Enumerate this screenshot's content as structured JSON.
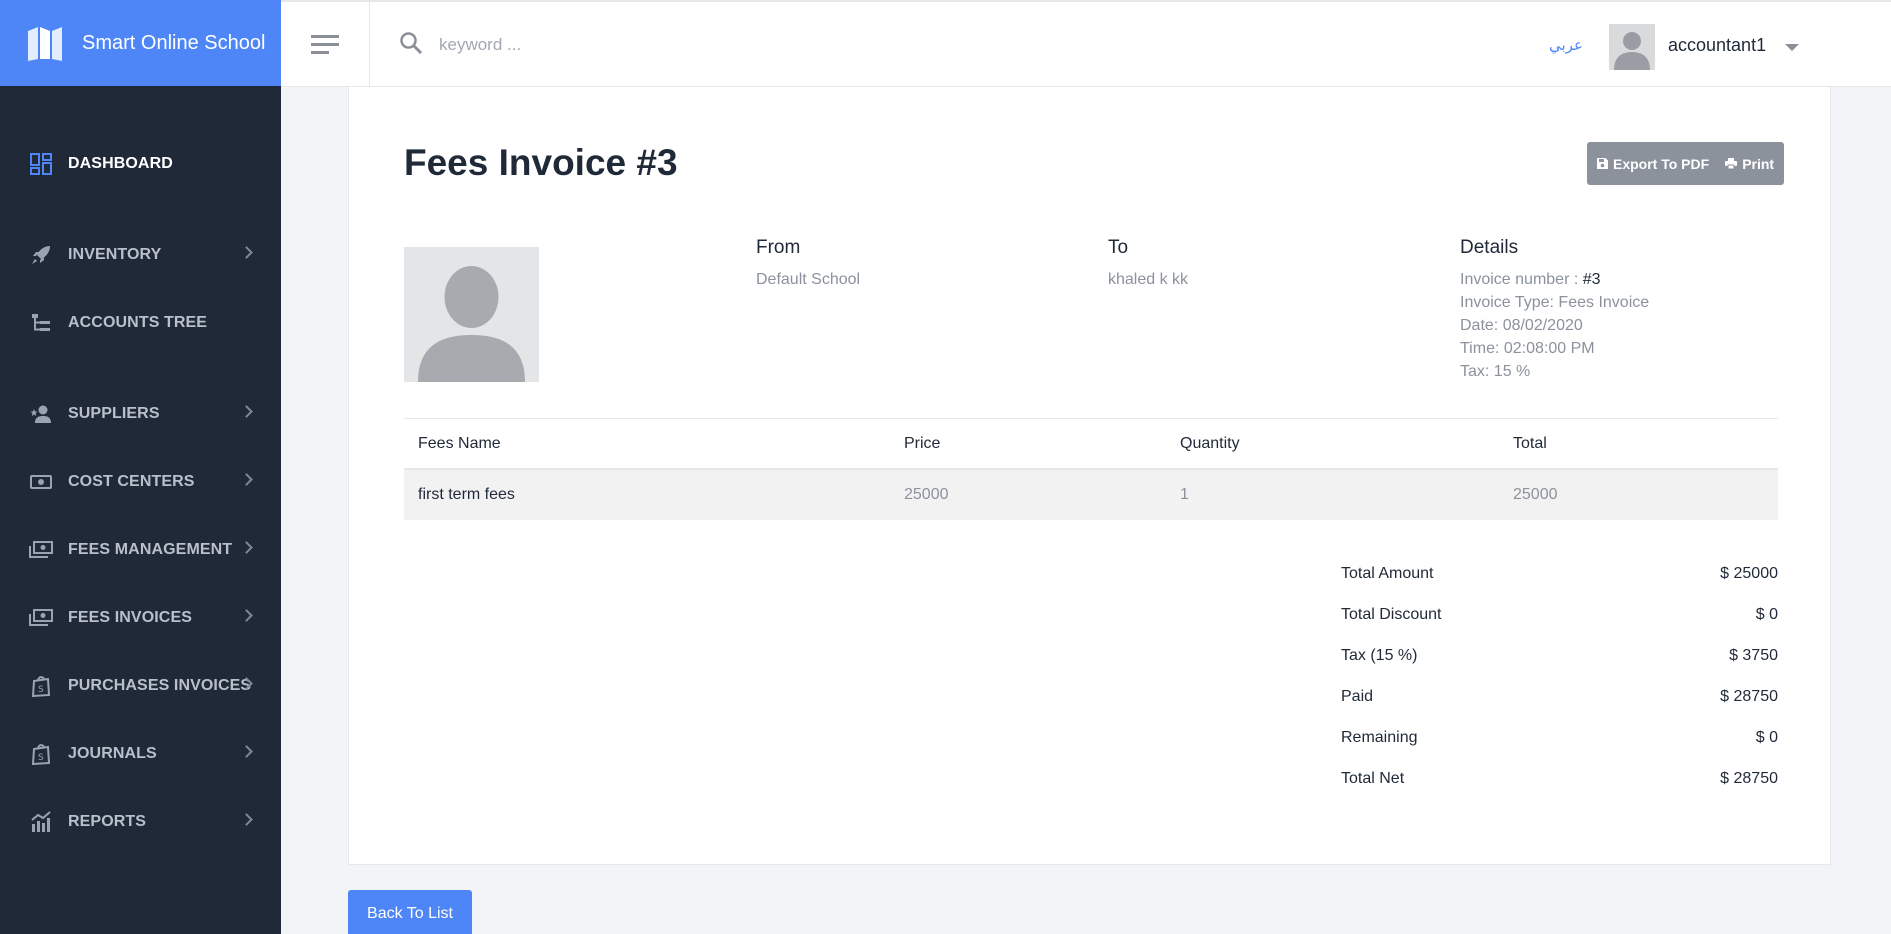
{
  "app": {
    "title": "Smart Online School"
  },
  "sidebar": {
    "items": [
      {
        "label": "DASHBOARD",
        "icon": "dashboard-icon"
      },
      {
        "label": "INVENTORY",
        "icon": "rocket-icon"
      },
      {
        "label": "ACCOUNTS TREE",
        "icon": "tree-icon"
      },
      {
        "label": "SUPPLIERS",
        "icon": "user-star-icon"
      },
      {
        "label": "COST CENTERS",
        "icon": "money-icon"
      },
      {
        "label": "FEES MANAGEMENT",
        "icon": "money-stack-icon"
      },
      {
        "label": "FEES INVOICES",
        "icon": "money-stack-icon"
      },
      {
        "label": "PURCHASES INVOICES",
        "icon": "shopping-bag-icon"
      },
      {
        "label": "JOURNALS",
        "icon": "shopping-bag-icon"
      },
      {
        "label": "REPORTS",
        "icon": "chart-icon"
      }
    ]
  },
  "header": {
    "search_placeholder": "keyword ...",
    "language_link": "عربي",
    "user_name": "accountant1"
  },
  "invoice": {
    "title": "Fees Invoice #3",
    "export_label": "Export To PDF",
    "print_label": "Print",
    "from_heading": "From",
    "from_value": "Default School",
    "to_heading": "To",
    "to_value": "khaled k kk",
    "details_heading": "Details",
    "details": {
      "number_label": "Invoice number : ",
      "number_value": "#3",
      "type": "Invoice Type: Fees Invoice",
      "date": "Date: 08/02/2020",
      "time": "Time: 02:08:00 PM",
      "tax": "Tax: 15 %"
    }
  },
  "table": {
    "headers": [
      "Fees Name",
      "Price",
      "Quantity",
      "Total"
    ],
    "rows": [
      [
        "first term fees",
        "25000",
        "1",
        "25000"
      ]
    ]
  },
  "summary": [
    {
      "label": "Total Amount",
      "value": "$ 25000"
    },
    {
      "label": "Total Discount",
      "value": "$ 0"
    },
    {
      "label": "Tax (15 %)",
      "value": "$ 3750"
    },
    {
      "label": "Paid",
      "value": "$ 28750"
    },
    {
      "label": "Remaining",
      "value": "$ 0"
    },
    {
      "label": "Total Net",
      "value": "$ 28750"
    }
  ],
  "back_label": "Back To List",
  "colors": {
    "accent": "#4e86f7",
    "sidebar_bg": "#1f2937",
    "button_grey": "#8b929c"
  }
}
